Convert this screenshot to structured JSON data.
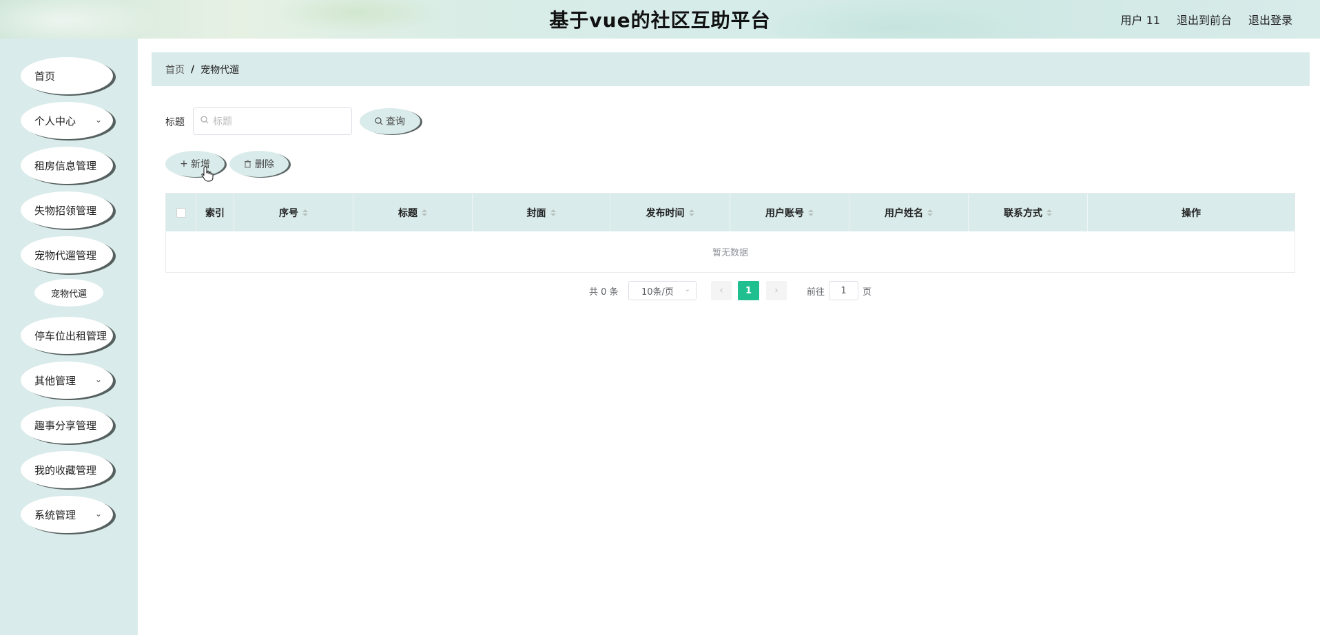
{
  "header": {
    "title": "基于vue的社区互助平台",
    "user": "用户 11",
    "to_front": "退出到前台",
    "logout": "退出登录"
  },
  "sidebar": {
    "items": [
      {
        "label": "首页",
        "chevron": false
      },
      {
        "label": "个人中心",
        "chevron": true
      },
      {
        "label": "租房信息管理",
        "chevron": false
      },
      {
        "label": "失物招领管理",
        "chevron": false
      },
      {
        "label": "宠物代遛管理",
        "chevron": false
      },
      {
        "label": "停车位出租管理",
        "chevron": false
      },
      {
        "label": "其他管理",
        "chevron": true
      },
      {
        "label": "趣事分享管理",
        "chevron": false
      },
      {
        "label": "我的收藏管理",
        "chevron": false
      },
      {
        "label": "系统管理",
        "chevron": true
      }
    ],
    "sub_item": "宠物代遛"
  },
  "breadcrumb": {
    "home": "首页",
    "sep": "/",
    "current": "宠物代遛"
  },
  "search": {
    "label": "标题",
    "placeholder": "标题",
    "query_button": "查询"
  },
  "actions": {
    "add": "新增",
    "delete": "删除"
  },
  "table": {
    "columns": [
      {
        "label": "索引",
        "sortable": false
      },
      {
        "label": "序号",
        "sortable": true
      },
      {
        "label": "标题",
        "sortable": true
      },
      {
        "label": "封面",
        "sortable": true
      },
      {
        "label": "发布时间",
        "sortable": true
      },
      {
        "label": "用户账号",
        "sortable": true
      },
      {
        "label": "用户姓名",
        "sortable": true
      },
      {
        "label": "联系方式",
        "sortable": true
      },
      {
        "label": "操作",
        "sortable": false
      }
    ],
    "empty_text": "暂无数据"
  },
  "pagination": {
    "total_text": "共 0 条",
    "page_size": "10条/页",
    "current_page": "1",
    "goto_label": "前往",
    "goto_value": "1",
    "page_suffix": "页"
  },
  "colors": {
    "accent": "#1fbf8f",
    "sidebar_bg": "#d9ebea",
    "header_bg": "#d6ece9"
  }
}
